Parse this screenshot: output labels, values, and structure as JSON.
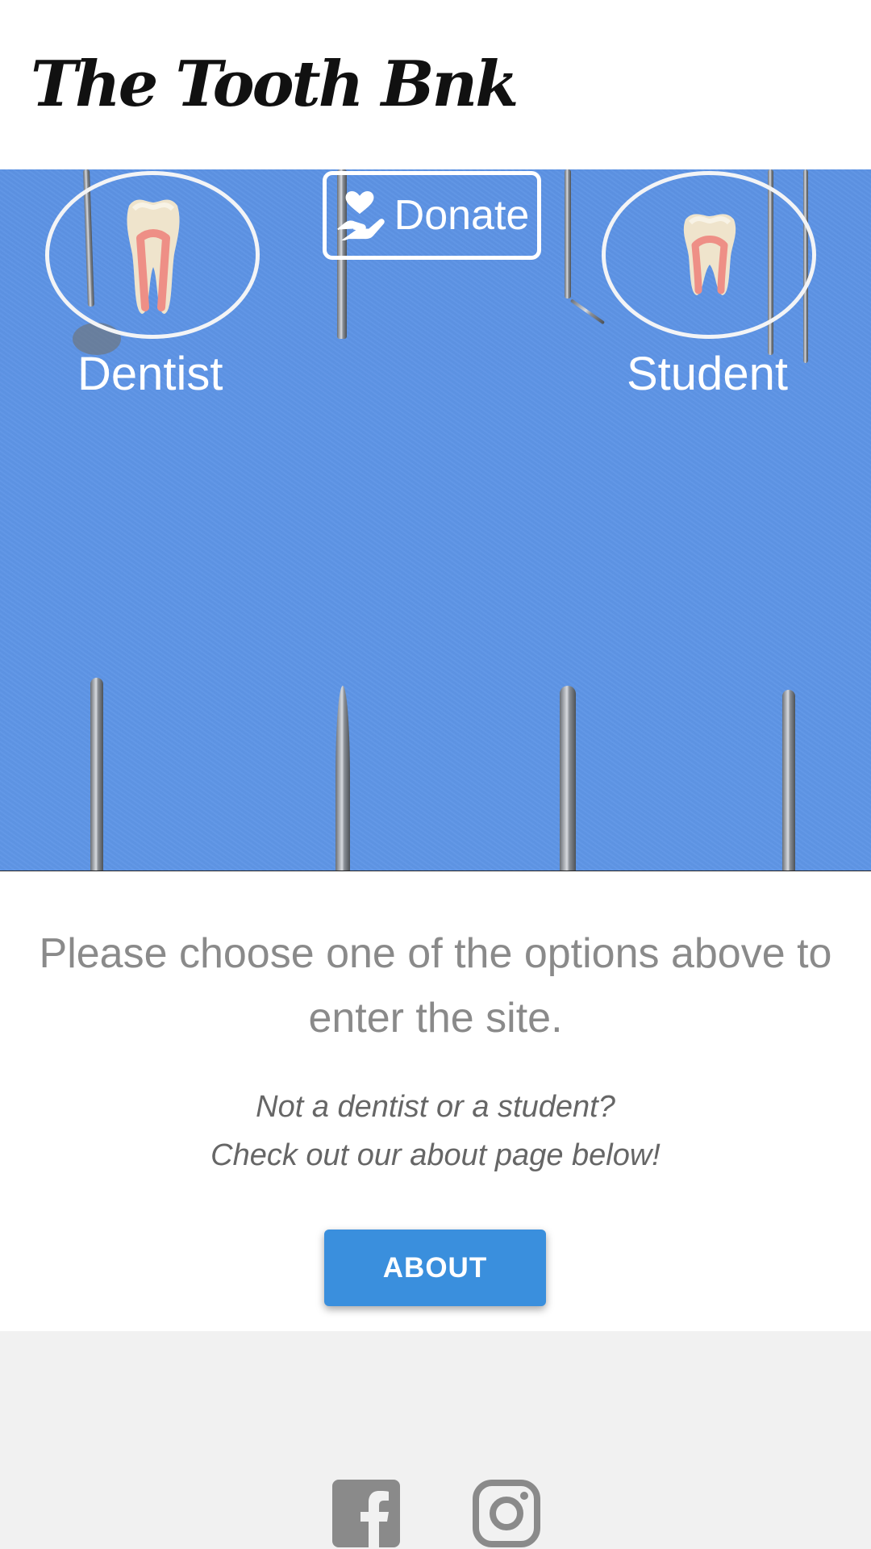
{
  "header": {
    "logo_text_before": "The Tooth B",
    "logo_text_after": "nk"
  },
  "hero": {
    "dentist_label": "Dentist",
    "student_label": "Student",
    "donate_label": "Donate"
  },
  "intro": {
    "main_text": "Please choose one of the options above to enter the site.",
    "sub_line_1": "Not a dentist or a student?",
    "sub_line_2": "Check out our about page below!",
    "about_label": "ABOUT"
  },
  "colors": {
    "hero_blue": "#5f96e6",
    "about_button": "#3a8fdd",
    "footer_bg": "#f1f1f1",
    "social_icon": "#8a8a8a"
  },
  "icons": {
    "social": [
      "facebook-icon",
      "instagram-icon"
    ],
    "donate": "heart-hand-icon",
    "choices": [
      "tooth-icon",
      "tooth-icon"
    ]
  }
}
